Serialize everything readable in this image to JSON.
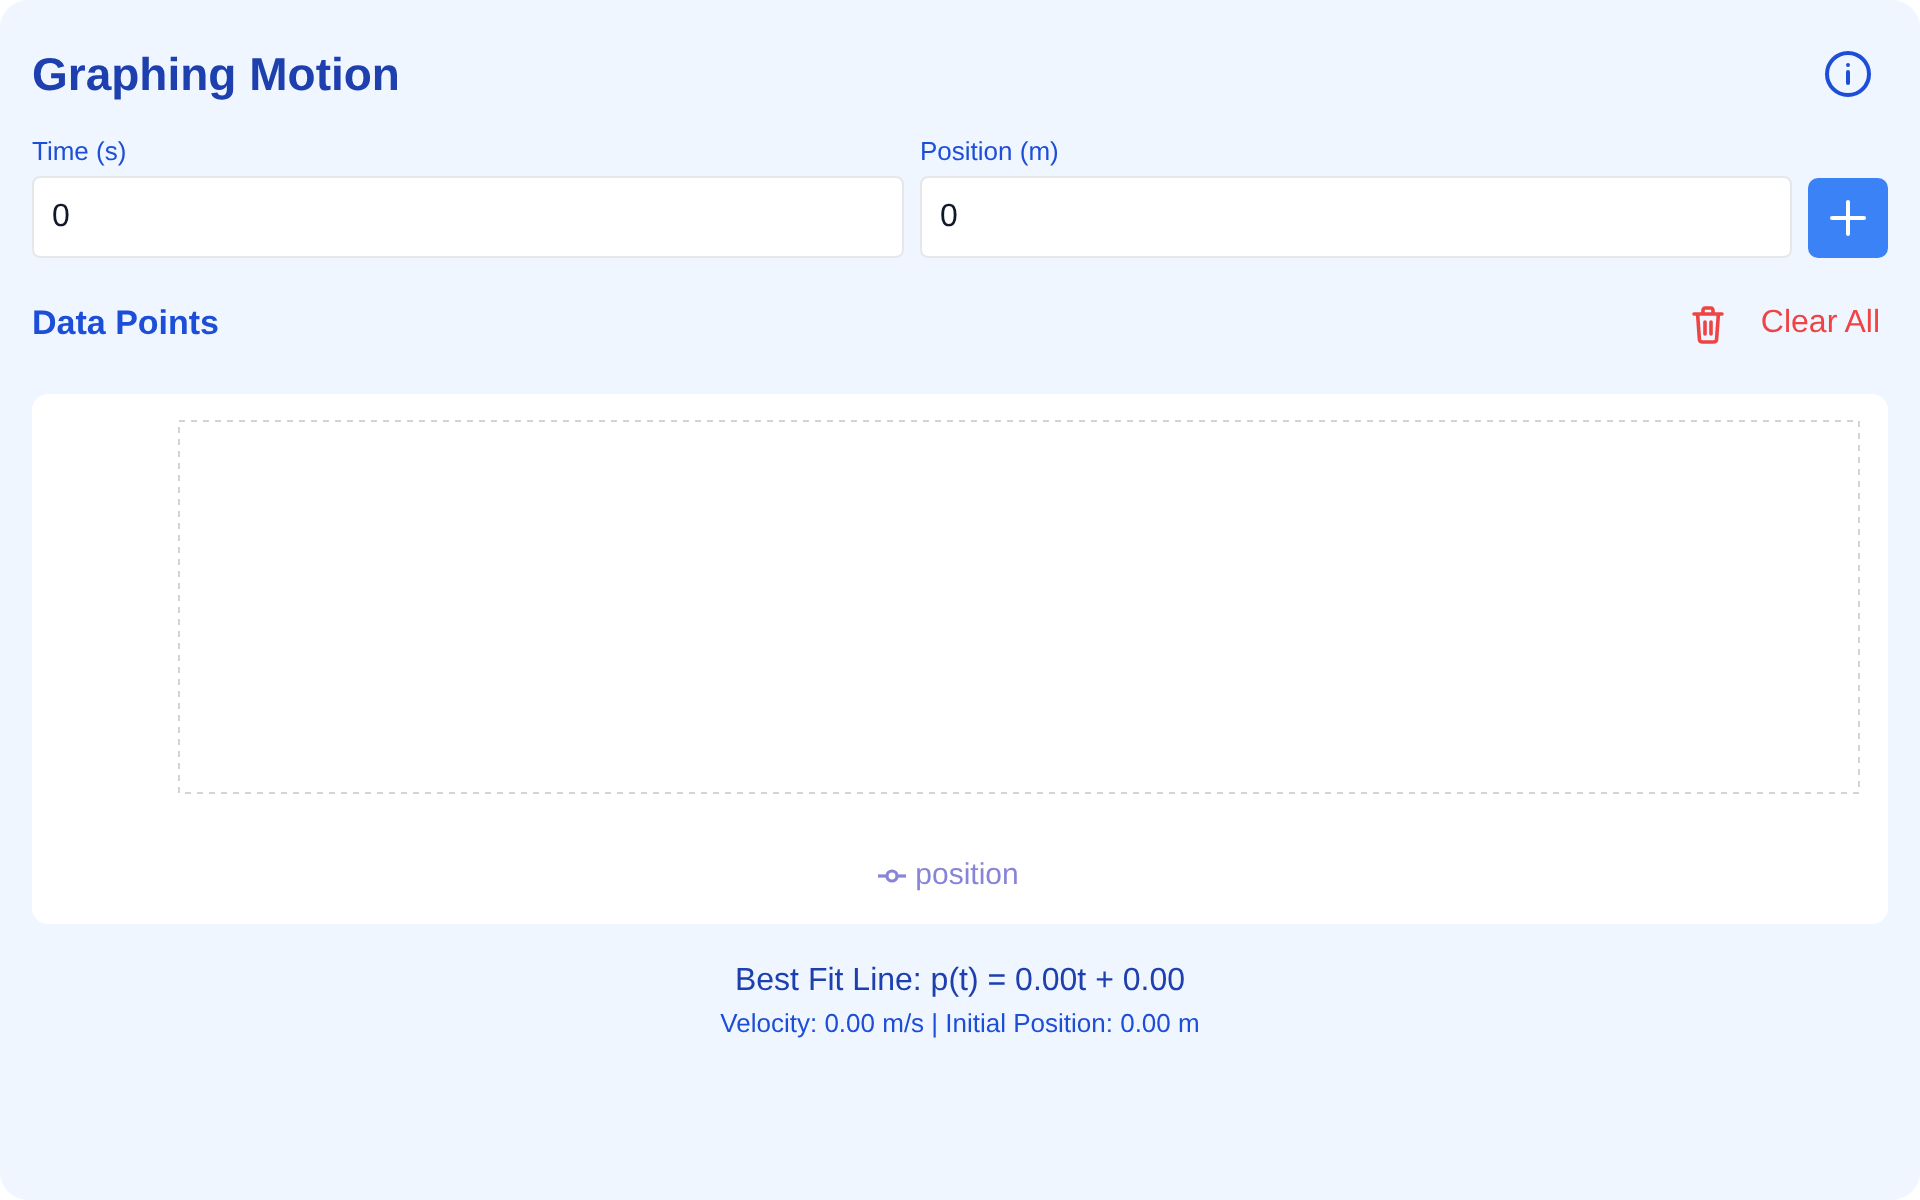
{
  "header": {
    "title": "Graphing Motion"
  },
  "inputs": [
    {
      "label": "Time (s)",
      "value": "0"
    },
    {
      "label": "Position (m)",
      "value": "0"
    }
  ],
  "data_points": {
    "title": "Data Points",
    "clear_button": "Clear All"
  },
  "chart": {
    "legend": [
      {
        "label": "position",
        "color": "#8884d8"
      }
    ]
  },
  "best_fit": {
    "equation": "Best Fit Line: p(t) = 0.00t + 0.00",
    "details": "Velocity: 0.00 m/s | Initial Position: 0.00 m"
  }
}
